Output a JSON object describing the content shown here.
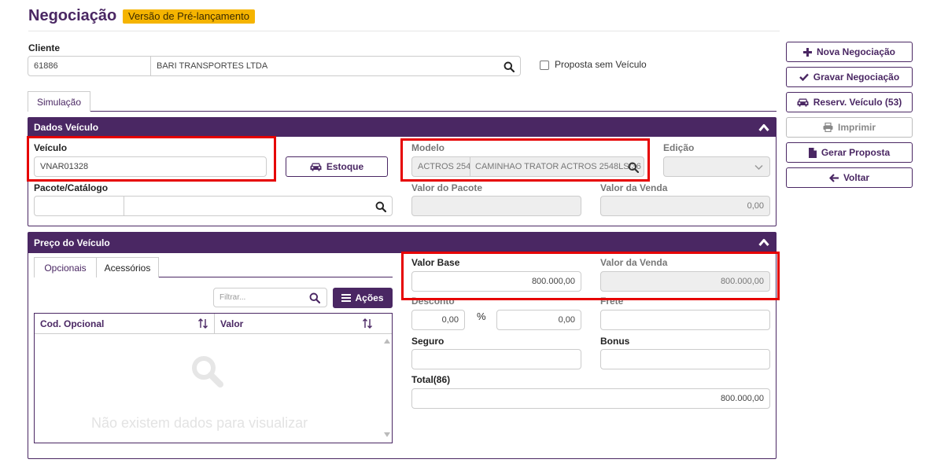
{
  "header": {
    "title": "Negociação",
    "badge": "Versão de Pré-lançamento"
  },
  "cliente": {
    "label": "Cliente",
    "code": "61886",
    "name": "BARI TRANSPORTES LTDA",
    "proposta_sem_veiculo": "Proposta sem Veículo"
  },
  "tabs": {
    "simulacao": "Simulação"
  },
  "dados_veiculo": {
    "title": "Dados Veículo",
    "veiculo_label": "Veículo",
    "veiculo_value": "VNAR01328",
    "estoque_button": "Estoque",
    "modelo_label": "Modelo",
    "modelo_code": "ACTROS 254",
    "modelo_desc": "CAMINHAO TRATOR ACTROS 2548LS/36",
    "edicao_label": "Edição",
    "pacote_label": "Pacote/Catálogo",
    "valor_pacote_label": "Valor do Pacote",
    "valor_venda_label": "Valor da Venda",
    "valor_venda_value": "0,00"
  },
  "preco_veiculo": {
    "title": "Preço do Veículo",
    "tab_opcionais": "Opcionais",
    "tab_acessorios": "Acessórios",
    "filter_placeholder": "Filtrar...",
    "acoes_button": "Ações",
    "col_cod": "Cod. Opcional",
    "col_valor": "Valor",
    "empty_message": "Não existem dados para visualizar",
    "valor_base_label": "Valor Base",
    "valor_base_value": "800.000,00",
    "valor_venda_label": "Valor da Venda",
    "valor_venda_value": "800.000,00",
    "desconto_label": "Desconto",
    "desconto_pct": "0,00",
    "pct_symbol": "%",
    "desconto_value": "0,00",
    "frete_label": "Frete",
    "seguro_label": "Seguro",
    "bonus_label": "Bonus",
    "total_label": "Total(86)",
    "total_value": "800.000,00"
  },
  "actions": {
    "nova": "Nova Negociação",
    "gravar": "Gravar Negociação",
    "reserv": "Reserv. Veículo (53)",
    "imprimir": "Imprimir",
    "gerar": "Gerar Proposta",
    "voltar": "Voltar"
  },
  "colors": {
    "brand": "#4a2763",
    "badge": "#f5b400",
    "highlight": "#e60000"
  }
}
